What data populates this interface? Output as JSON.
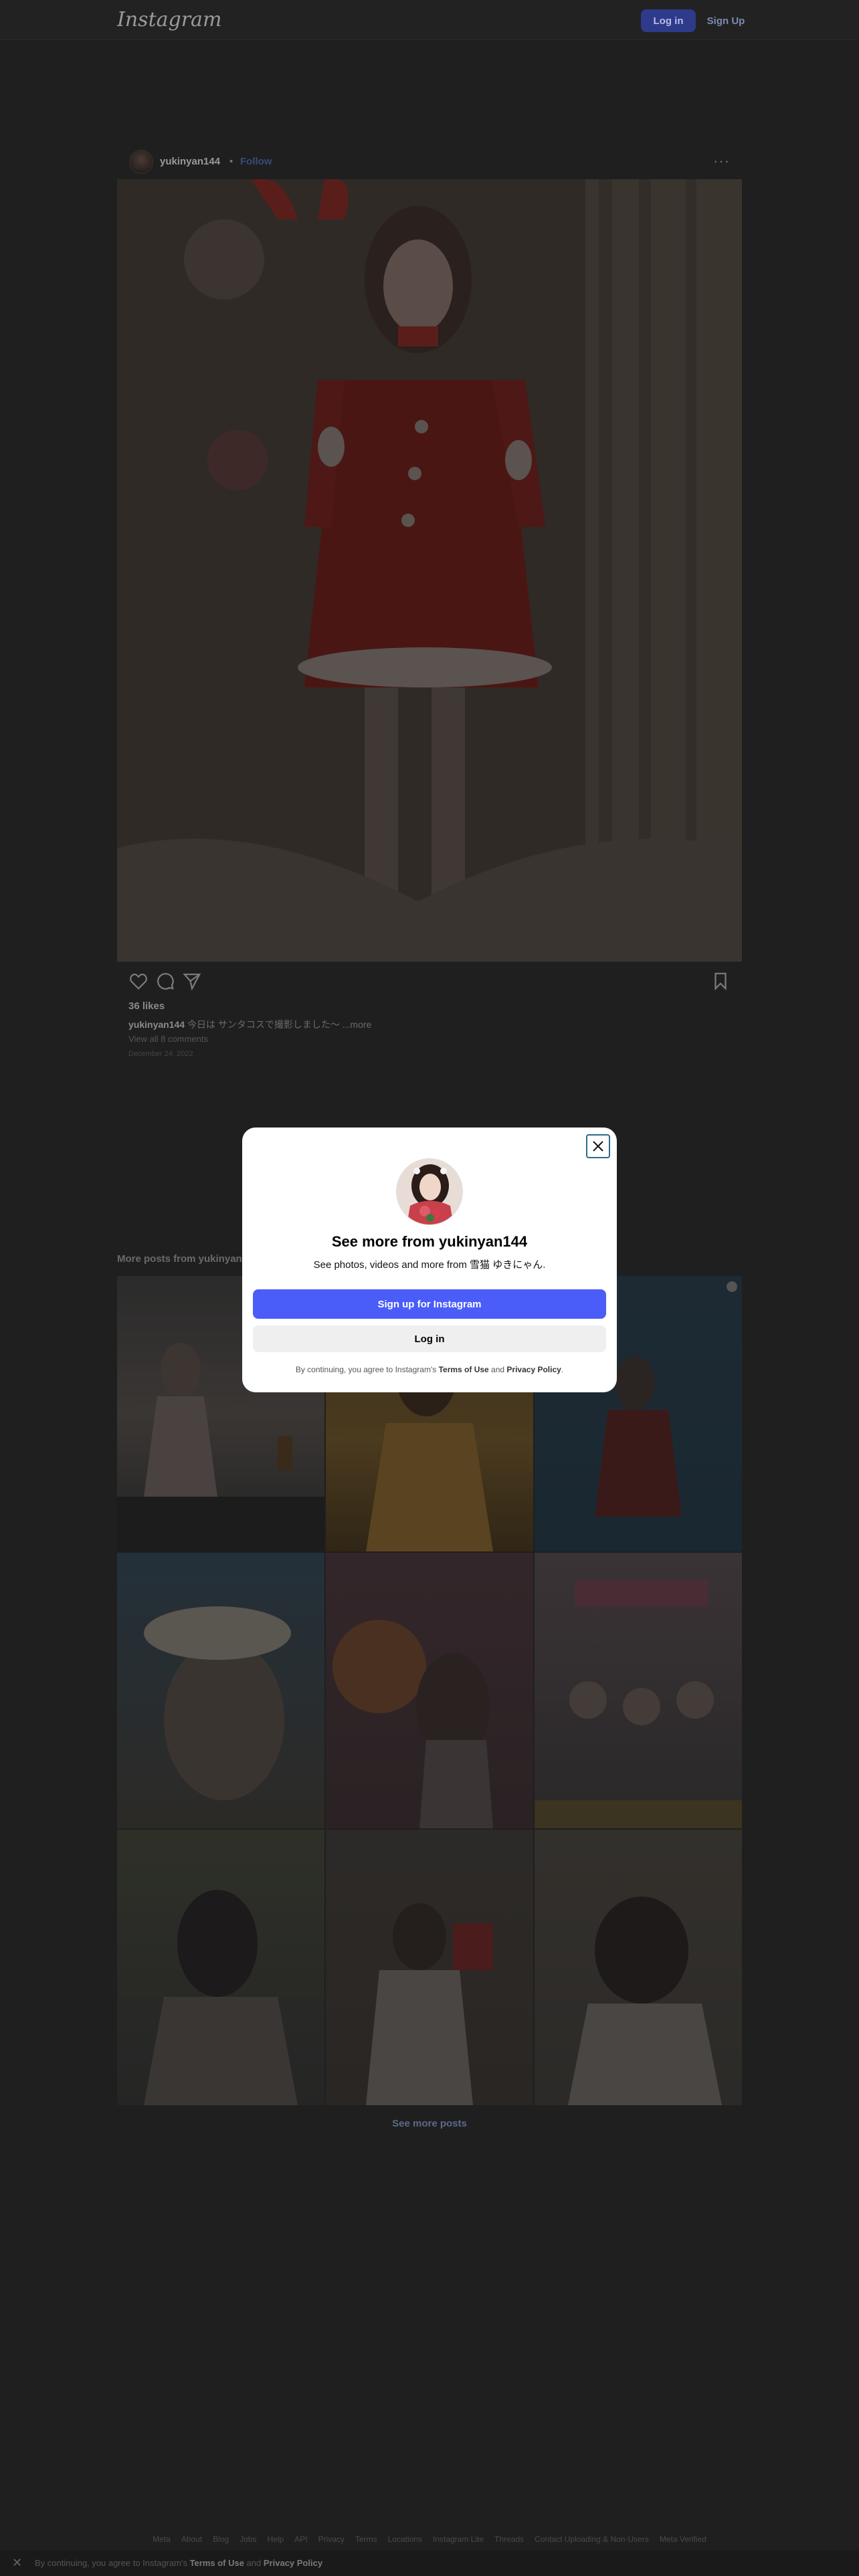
{
  "nav": {
    "logo": "Instagram",
    "login_label": "Log in",
    "signup_label": "Sign Up"
  },
  "post": {
    "username": "yukinyan144",
    "separator": "•",
    "follow_label": "Follow",
    "more_label": "···",
    "likes": "36 likes",
    "caption_user": "yukinyan144",
    "caption_text": "今日は サンタコスで撮影しました〜 ...more",
    "view_comments": "View all 8 comments",
    "date": "December 24, 2022"
  },
  "more_posts": {
    "title": "More posts from yukinyan144",
    "see_more": "See more posts"
  },
  "modal": {
    "title": "See more from yukinyan144",
    "subtitle": "See photos, videos and more from 雪猫 ゆきにゃん.",
    "signup_label": "Sign up for Instagram",
    "login_label": "Log in",
    "legal_prefix": "By continuing, you agree to Instagram's ",
    "legal_terms": "Terms of Use",
    "legal_and": " and ",
    "legal_privacy": "Privacy Policy",
    "legal_suffix": "."
  },
  "footer": {
    "links": [
      "Meta",
      "About",
      "Blog",
      "Jobs",
      "Help",
      "API",
      "Privacy",
      "Terms",
      "Locations",
      "Instagram Lite",
      "Threads",
      "Contact Uploading & Non-Users",
      "Meta Verified"
    ]
  },
  "cookie": {
    "close_label": "✕",
    "prefix": "By continuing, you agree to Instagram's ",
    "terms": "Terms of Use",
    "and": " and ",
    "privacy": "Privacy Policy"
  },
  "colors": {
    "accent": "#4a5df9",
    "overlay": "#1f1f1f",
    "modal_bg": "#ffffff"
  }
}
